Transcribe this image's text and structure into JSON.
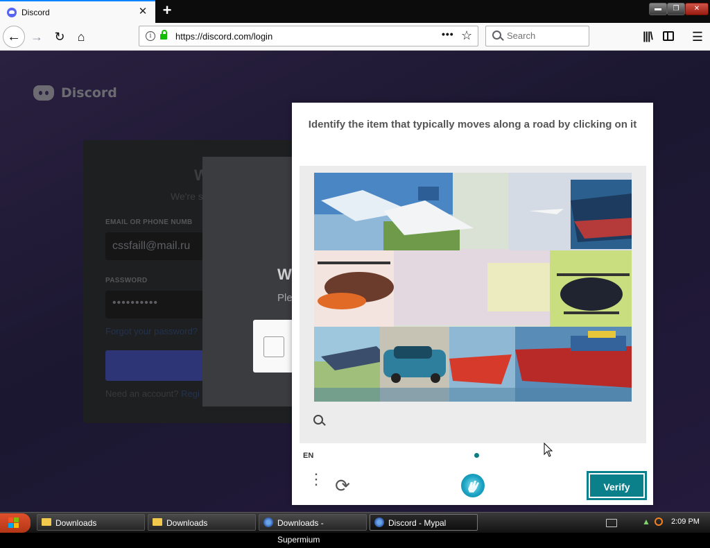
{
  "browser": {
    "tab_title": "Discord",
    "tab_close": "✕",
    "new_tab": "+",
    "window_controls": {
      "minimize": "▬",
      "maximize": "❐",
      "close": "✕"
    },
    "url": "https://discord.com/login",
    "page_actions": "•••",
    "bookmark": "☆",
    "search_placeholder": "Search",
    "back": "←",
    "forward": "→",
    "reload": "↻",
    "home": "⌂",
    "library": "|||\\",
    "menu": "☰"
  },
  "page": {
    "logo_text": "Discord",
    "login_card": {
      "heading": "W",
      "subtitle": "We're s",
      "email_label": "EMAIL OR PHONE NUMB",
      "email_value": "cssfaill@mail.ru",
      "password_label": "PASSWORD",
      "password_value": "••••••••••",
      "forgot_link": "Forgot your password?",
      "register_prefix": "Need an account? ",
      "register_link": "Regi"
    },
    "overlay": {
      "heading": "W",
      "text": "Ple"
    }
  },
  "challenge": {
    "prompt": "Identify the item that typically moves along a road by clicking on it",
    "language": "EN",
    "more_menu": "⋮",
    "refresh_icon": "⟳",
    "verify_label": "Verify",
    "colors": {
      "accent": "#0b7f8a"
    }
  },
  "taskbar": {
    "items": [
      {
        "label": "Downloads"
      },
      {
        "label": "Downloads"
      },
      {
        "label": "Downloads - Supermium"
      },
      {
        "label": "Discord - Mypal"
      }
    ],
    "clock": "2:09 PM"
  }
}
